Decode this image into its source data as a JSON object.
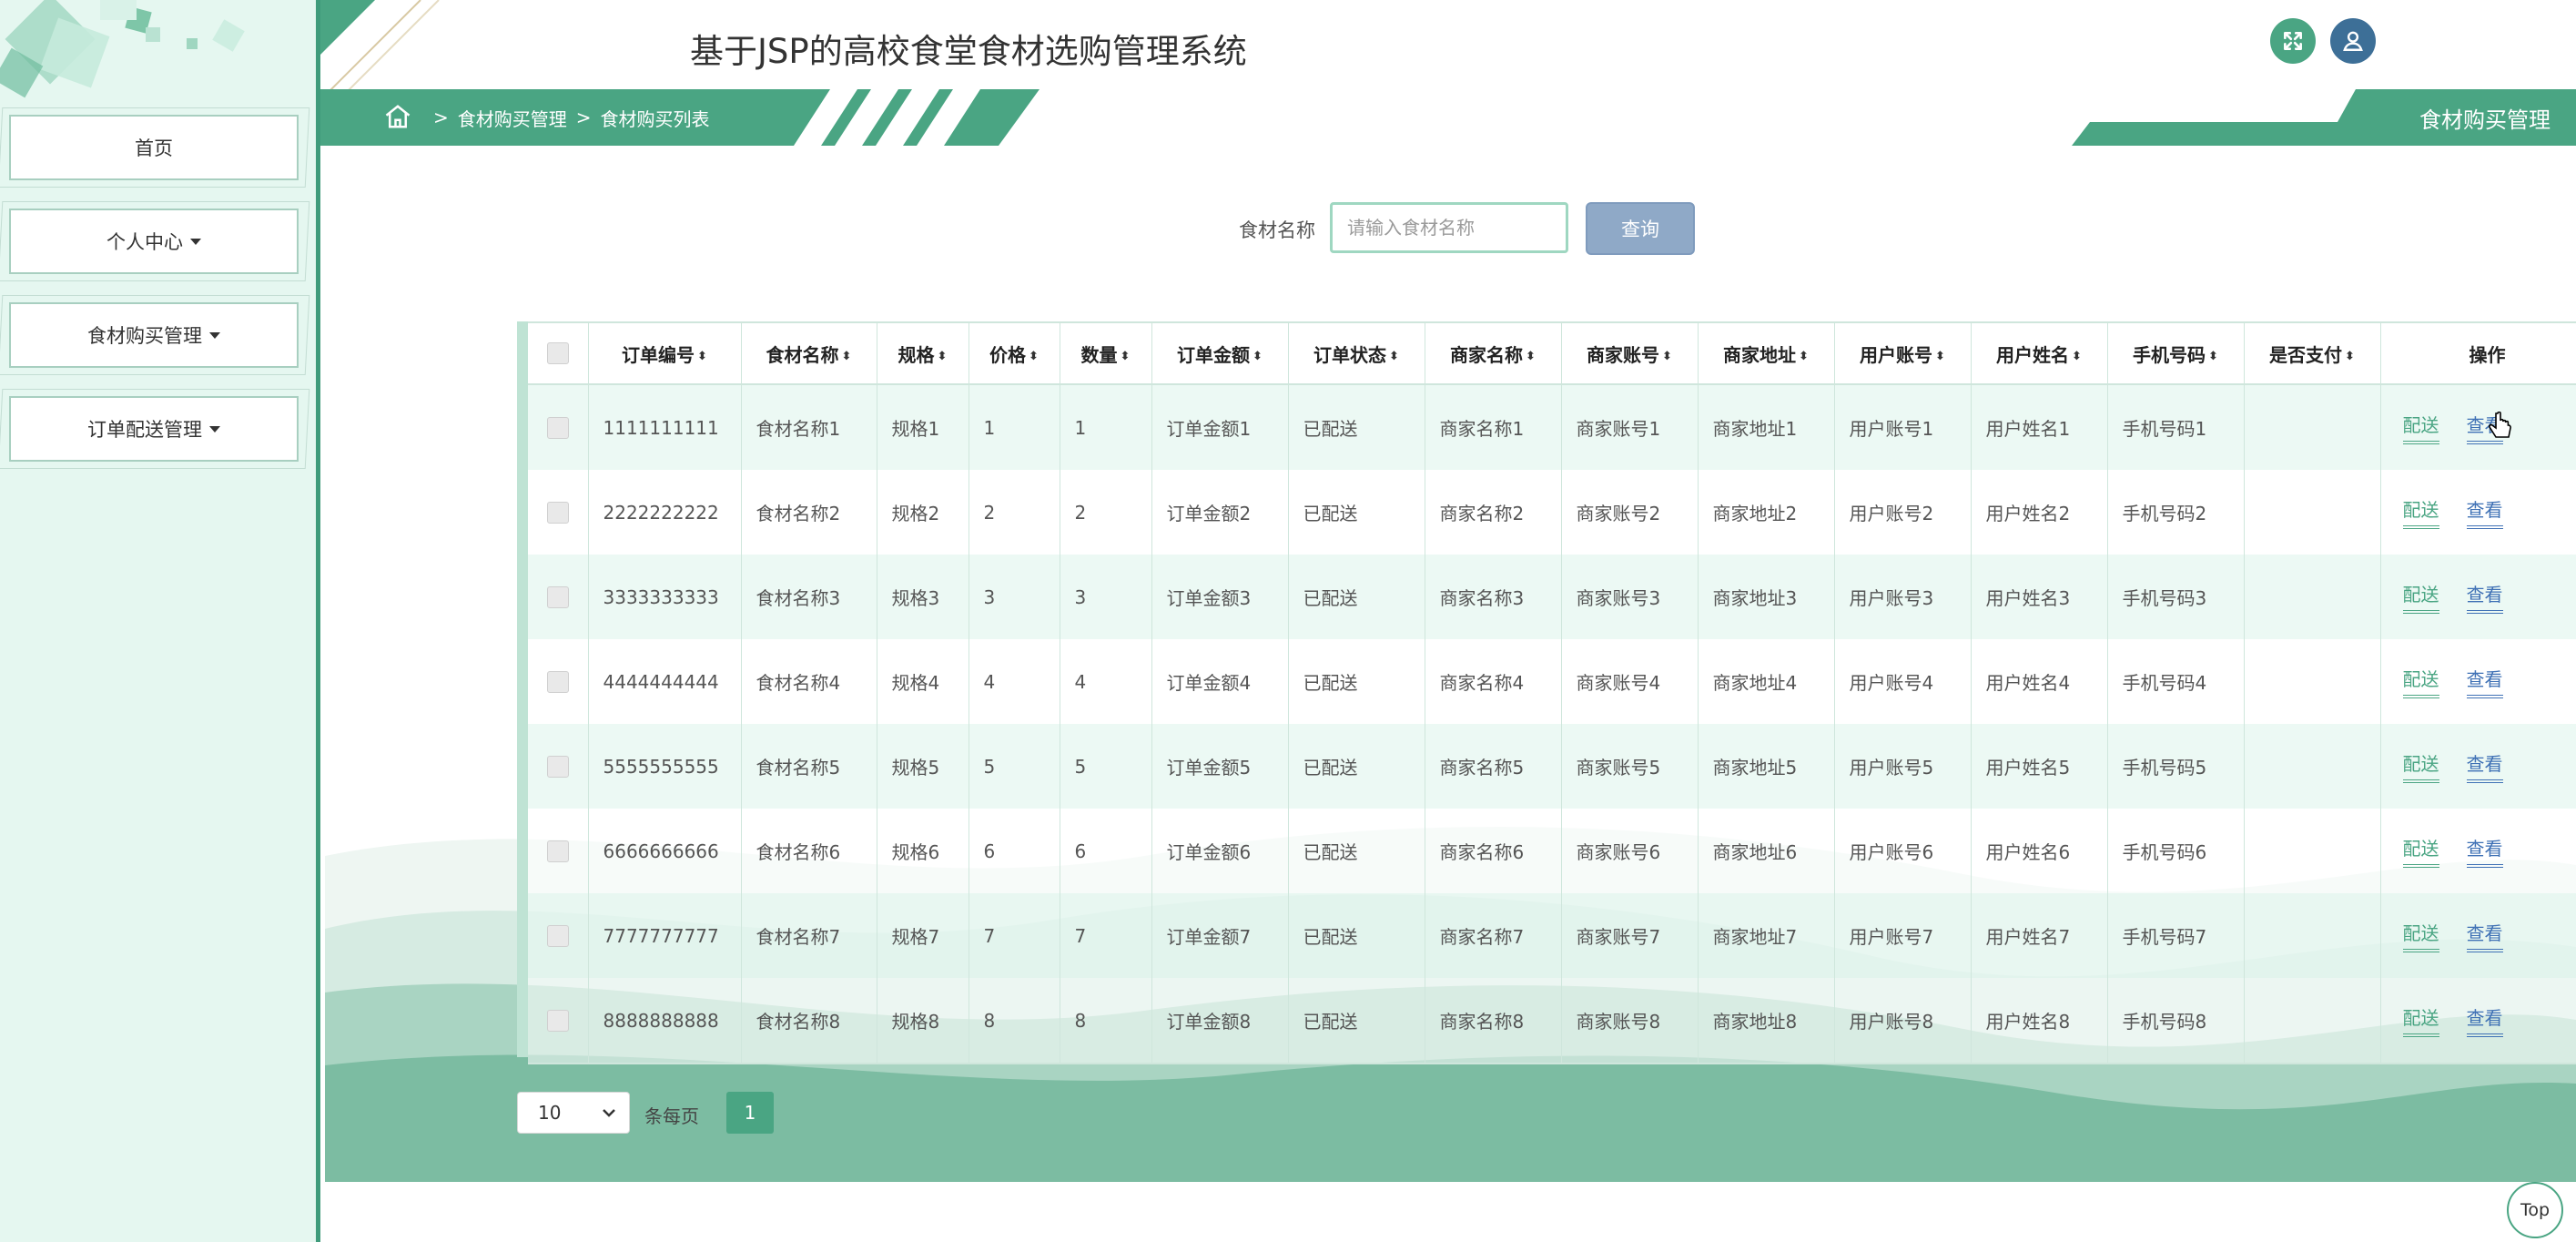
{
  "app": {
    "title": "基于JSP的高校食堂食材选购管理系统"
  },
  "sidebar": {
    "items": [
      {
        "label": "首页",
        "has_caret": false
      },
      {
        "label": "个人中心",
        "has_caret": true
      },
      {
        "label": "食材购买管理",
        "has_caret": true
      },
      {
        "label": "订单配送管理",
        "has_caret": true
      }
    ]
  },
  "breadcrumb": {
    "sep": ">",
    "items": [
      "食材购买管理",
      "食材购买列表"
    ]
  },
  "section_tab": {
    "label": "食材购买管理"
  },
  "search": {
    "label": "食材名称",
    "placeholder": "请输入食材名称",
    "button": "查询"
  },
  "table": {
    "columns": [
      "订单编号",
      "食材名称",
      "规格",
      "价格",
      "数量",
      "订单金额",
      "订单状态",
      "商家名称",
      "商家账号",
      "商家地址",
      "用户账号",
      "用户姓名",
      "手机号码",
      "是否支付",
      "操作"
    ],
    "rows": [
      [
        "1111111111",
        "食材名称1",
        "规格1",
        "1",
        "1",
        "订单金额1",
        "已配送",
        "商家名称1",
        "商家账号1",
        "商家地址1",
        "用户账号1",
        "用户姓名1",
        "手机号码1",
        ""
      ],
      [
        "2222222222",
        "食材名称2",
        "规格2",
        "2",
        "2",
        "订单金额2",
        "已配送",
        "商家名称2",
        "商家账号2",
        "商家地址2",
        "用户账号2",
        "用户姓名2",
        "手机号码2",
        ""
      ],
      [
        "3333333333",
        "食材名称3",
        "规格3",
        "3",
        "3",
        "订单金额3",
        "已配送",
        "商家名称3",
        "商家账号3",
        "商家地址3",
        "用户账号3",
        "用户姓名3",
        "手机号码3",
        ""
      ],
      [
        "4444444444",
        "食材名称4",
        "规格4",
        "4",
        "4",
        "订单金额4",
        "已配送",
        "商家名称4",
        "商家账号4",
        "商家地址4",
        "用户账号4",
        "用户姓名4",
        "手机号码4",
        ""
      ],
      [
        "5555555555",
        "食材名称5",
        "规格5",
        "5",
        "5",
        "订单金额5",
        "已配送",
        "商家名称5",
        "商家账号5",
        "商家地址5",
        "用户账号5",
        "用户姓名5",
        "手机号码5",
        ""
      ],
      [
        "6666666666",
        "食材名称6",
        "规格6",
        "6",
        "6",
        "订单金额6",
        "已配送",
        "商家名称6",
        "商家账号6",
        "商家地址6",
        "用户账号6",
        "用户姓名6",
        "手机号码6",
        ""
      ],
      [
        "7777777777",
        "食材名称7",
        "规格7",
        "7",
        "7",
        "订单金额7",
        "已配送",
        "商家名称7",
        "商家账号7",
        "商家地址7",
        "用户账号7",
        "用户姓名7",
        "手机号码7",
        ""
      ],
      [
        "8888888888",
        "食材名称8",
        "规格8",
        "8",
        "8",
        "订单金额8",
        "已配送",
        "商家名称8",
        "商家账号8",
        "商家地址8",
        "用户账号8",
        "用户姓名8",
        "手机号码8",
        ""
      ]
    ],
    "actions": {
      "deliver": "配送",
      "view": "查看"
    },
    "sort_glyph": "⬍"
  },
  "pagination": {
    "page_size": "10",
    "per_page_label": "条每页",
    "current_page": "1"
  },
  "top_button": {
    "label": "Top"
  },
  "icons": {
    "fullscreen": "fullscreen-icon",
    "user": "user-icon",
    "home": "home-icon",
    "caret": "caret-down-icon",
    "sort": "sort-icon"
  },
  "colors": {
    "accent": "#4aa583",
    "accent_dark": "#3f9b7b",
    "sidebar_bg": "#e5f7f0",
    "view_link": "#3f71b5",
    "user_btn": "#3d6f97",
    "search_btn": "#8fa9c7"
  }
}
